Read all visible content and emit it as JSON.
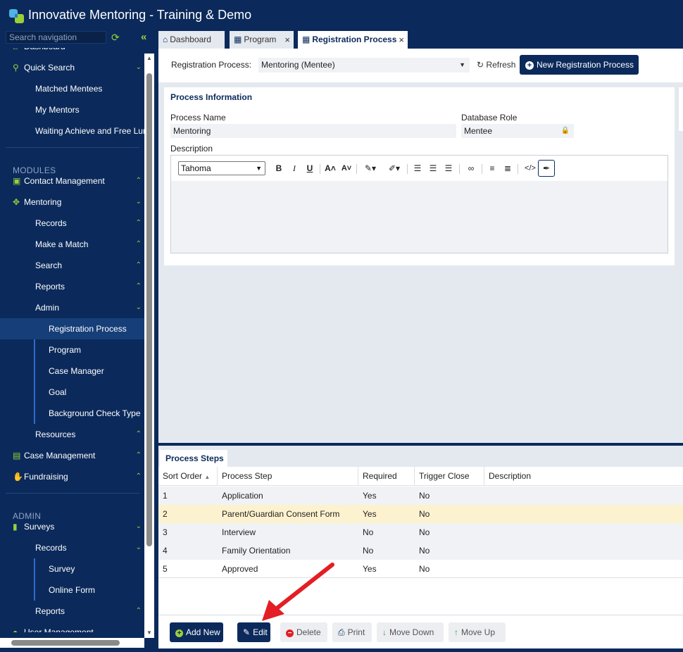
{
  "app": {
    "title": "Innovative Mentoring - Training & Demo"
  },
  "sidebar": {
    "search_placeholder": "Search navigation",
    "items": [
      {
        "label": "Dashboard"
      },
      {
        "label": "Quick Search"
      },
      {
        "label": "Matched Mentees"
      },
      {
        "label": "My Mentors"
      },
      {
        "label": "Waiting Achieve and Free Lunch"
      },
      {
        "label": "Contact Management"
      },
      {
        "label": "Mentoring"
      },
      {
        "label": "Records"
      },
      {
        "label": "Make a Match"
      },
      {
        "label": "Search"
      },
      {
        "label": "Reports"
      },
      {
        "label": "Admin"
      },
      {
        "label": "Registration Process"
      },
      {
        "label": "Program"
      },
      {
        "label": "Case Manager"
      },
      {
        "label": "Goal"
      },
      {
        "label": "Background Check Type"
      },
      {
        "label": "Resources"
      },
      {
        "label": "Case Management"
      },
      {
        "label": "Fundraising"
      },
      {
        "label": "Surveys"
      },
      {
        "label": "Records"
      },
      {
        "label": "Survey"
      },
      {
        "label": "Online Form"
      },
      {
        "label": "Reports"
      },
      {
        "label": "User Management"
      }
    ],
    "sections": {
      "modules": "MODULES",
      "admin": "ADMIN"
    }
  },
  "tabs": [
    {
      "label": "Dashboard"
    },
    {
      "label": "Program"
    },
    {
      "label": "Registration Process"
    }
  ],
  "toolbar": {
    "label": "Registration Process:",
    "selected": "Mentoring (Mentee)",
    "refresh": "Refresh",
    "new_button": "New Registration Process"
  },
  "process_info": {
    "title": "Process Information",
    "name_label": "Process Name",
    "name_value": "Mentoring",
    "role_label": "Database Role",
    "role_value": "Mentee",
    "description_label": "Description",
    "font": "Tahoma"
  },
  "steps": {
    "tab": "Process Steps",
    "columns": [
      "Sort Order",
      "Process Step",
      "Required",
      "Trigger Close",
      "Description"
    ],
    "rows": [
      [
        "1",
        "Application",
        "Yes",
        "No",
        ""
      ],
      [
        "2",
        "Parent/Guardian Consent Form",
        "Yes",
        "No",
        ""
      ],
      [
        "3",
        "Interview",
        "No",
        "No",
        ""
      ],
      [
        "4",
        "Family Orientation",
        "No",
        "No",
        ""
      ],
      [
        "5",
        "Approved",
        "Yes",
        "No",
        ""
      ]
    ],
    "selected_row": 1
  },
  "actions": {
    "add_new": "Add New",
    "edit": "Edit",
    "delete": "Delete",
    "print": "Print",
    "move_down": "Move Down",
    "move_up": "Move Up"
  },
  "colors": {
    "brand": "#0b2a5b",
    "accent": "#9bcf3a",
    "selected_row": "#fdf2cf",
    "arrow": "#e31e24"
  }
}
